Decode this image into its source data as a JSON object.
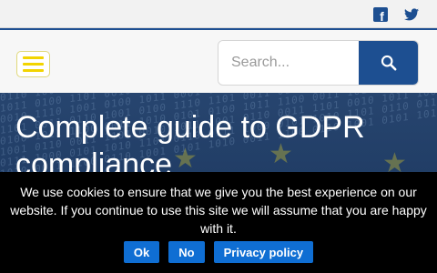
{
  "topbar": {
    "icons": [
      "facebook-icon",
      "twitter-icon"
    ]
  },
  "header": {
    "menu_icon": "hamburger-icon",
    "search": {
      "placeholder": "Search...",
      "value": "",
      "button_icon": "search-icon"
    }
  },
  "hero": {
    "title": "Complete guide to GDPR compliance"
  },
  "cookie_banner": {
    "message": "We use cookies to ensure that we give you the best experience on our website. If you continue to use this site we will assume that you are happy with it.",
    "buttons": {
      "ok": "Ok",
      "no": "No",
      "privacy": "Privacy policy"
    }
  },
  "colors": {
    "brand_blue": "#1d4f91",
    "menu_yellow": "#f2d400",
    "banner_button": "#0f6ed3"
  }
}
